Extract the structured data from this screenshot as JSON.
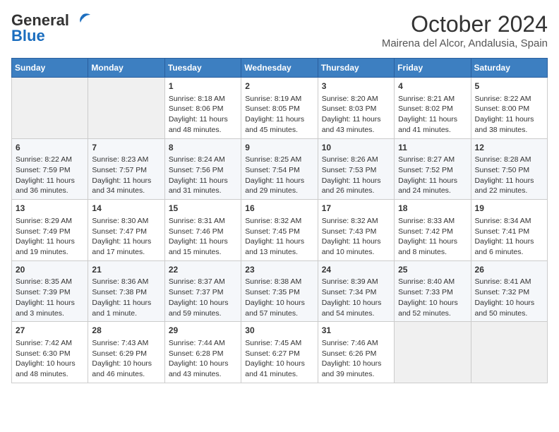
{
  "header": {
    "logo_line1": "General",
    "logo_line2": "Blue",
    "title": "October 2024",
    "subtitle": "Mairena del Alcor, Andalusia, Spain"
  },
  "weekdays": [
    "Sunday",
    "Monday",
    "Tuesday",
    "Wednesday",
    "Thursday",
    "Friday",
    "Saturday"
  ],
  "weeks": [
    [
      {
        "day": "",
        "info": ""
      },
      {
        "day": "",
        "info": ""
      },
      {
        "day": "1",
        "info": "Sunrise: 8:18 AM\nSunset: 8:06 PM\nDaylight: 11 hours and 48 minutes."
      },
      {
        "day": "2",
        "info": "Sunrise: 8:19 AM\nSunset: 8:05 PM\nDaylight: 11 hours and 45 minutes."
      },
      {
        "day": "3",
        "info": "Sunrise: 8:20 AM\nSunset: 8:03 PM\nDaylight: 11 hours and 43 minutes."
      },
      {
        "day": "4",
        "info": "Sunrise: 8:21 AM\nSunset: 8:02 PM\nDaylight: 11 hours and 41 minutes."
      },
      {
        "day": "5",
        "info": "Sunrise: 8:22 AM\nSunset: 8:00 PM\nDaylight: 11 hours and 38 minutes."
      }
    ],
    [
      {
        "day": "6",
        "info": "Sunrise: 8:22 AM\nSunset: 7:59 PM\nDaylight: 11 hours and 36 minutes."
      },
      {
        "day": "7",
        "info": "Sunrise: 8:23 AM\nSunset: 7:57 PM\nDaylight: 11 hours and 34 minutes."
      },
      {
        "day": "8",
        "info": "Sunrise: 8:24 AM\nSunset: 7:56 PM\nDaylight: 11 hours and 31 minutes."
      },
      {
        "day": "9",
        "info": "Sunrise: 8:25 AM\nSunset: 7:54 PM\nDaylight: 11 hours and 29 minutes."
      },
      {
        "day": "10",
        "info": "Sunrise: 8:26 AM\nSunset: 7:53 PM\nDaylight: 11 hours and 26 minutes."
      },
      {
        "day": "11",
        "info": "Sunrise: 8:27 AM\nSunset: 7:52 PM\nDaylight: 11 hours and 24 minutes."
      },
      {
        "day": "12",
        "info": "Sunrise: 8:28 AM\nSunset: 7:50 PM\nDaylight: 11 hours and 22 minutes."
      }
    ],
    [
      {
        "day": "13",
        "info": "Sunrise: 8:29 AM\nSunset: 7:49 PM\nDaylight: 11 hours and 19 minutes."
      },
      {
        "day": "14",
        "info": "Sunrise: 8:30 AM\nSunset: 7:47 PM\nDaylight: 11 hours and 17 minutes."
      },
      {
        "day": "15",
        "info": "Sunrise: 8:31 AM\nSunset: 7:46 PM\nDaylight: 11 hours and 15 minutes."
      },
      {
        "day": "16",
        "info": "Sunrise: 8:32 AM\nSunset: 7:45 PM\nDaylight: 11 hours and 13 minutes."
      },
      {
        "day": "17",
        "info": "Sunrise: 8:32 AM\nSunset: 7:43 PM\nDaylight: 11 hours and 10 minutes."
      },
      {
        "day": "18",
        "info": "Sunrise: 8:33 AM\nSunset: 7:42 PM\nDaylight: 11 hours and 8 minutes."
      },
      {
        "day": "19",
        "info": "Sunrise: 8:34 AM\nSunset: 7:41 PM\nDaylight: 11 hours and 6 minutes."
      }
    ],
    [
      {
        "day": "20",
        "info": "Sunrise: 8:35 AM\nSunset: 7:39 PM\nDaylight: 11 hours and 3 minutes."
      },
      {
        "day": "21",
        "info": "Sunrise: 8:36 AM\nSunset: 7:38 PM\nDaylight: 11 hours and 1 minute."
      },
      {
        "day": "22",
        "info": "Sunrise: 8:37 AM\nSunset: 7:37 PM\nDaylight: 10 hours and 59 minutes."
      },
      {
        "day": "23",
        "info": "Sunrise: 8:38 AM\nSunset: 7:35 PM\nDaylight: 10 hours and 57 minutes."
      },
      {
        "day": "24",
        "info": "Sunrise: 8:39 AM\nSunset: 7:34 PM\nDaylight: 10 hours and 54 minutes."
      },
      {
        "day": "25",
        "info": "Sunrise: 8:40 AM\nSunset: 7:33 PM\nDaylight: 10 hours and 52 minutes."
      },
      {
        "day": "26",
        "info": "Sunrise: 8:41 AM\nSunset: 7:32 PM\nDaylight: 10 hours and 50 minutes."
      }
    ],
    [
      {
        "day": "27",
        "info": "Sunrise: 7:42 AM\nSunset: 6:30 PM\nDaylight: 10 hours and 48 minutes."
      },
      {
        "day": "28",
        "info": "Sunrise: 7:43 AM\nSunset: 6:29 PM\nDaylight: 10 hours and 46 minutes."
      },
      {
        "day": "29",
        "info": "Sunrise: 7:44 AM\nSunset: 6:28 PM\nDaylight: 10 hours and 43 minutes."
      },
      {
        "day": "30",
        "info": "Sunrise: 7:45 AM\nSunset: 6:27 PM\nDaylight: 10 hours and 41 minutes."
      },
      {
        "day": "31",
        "info": "Sunrise: 7:46 AM\nSunset: 6:26 PM\nDaylight: 10 hours and 39 minutes."
      },
      {
        "day": "",
        "info": ""
      },
      {
        "day": "",
        "info": ""
      }
    ]
  ]
}
